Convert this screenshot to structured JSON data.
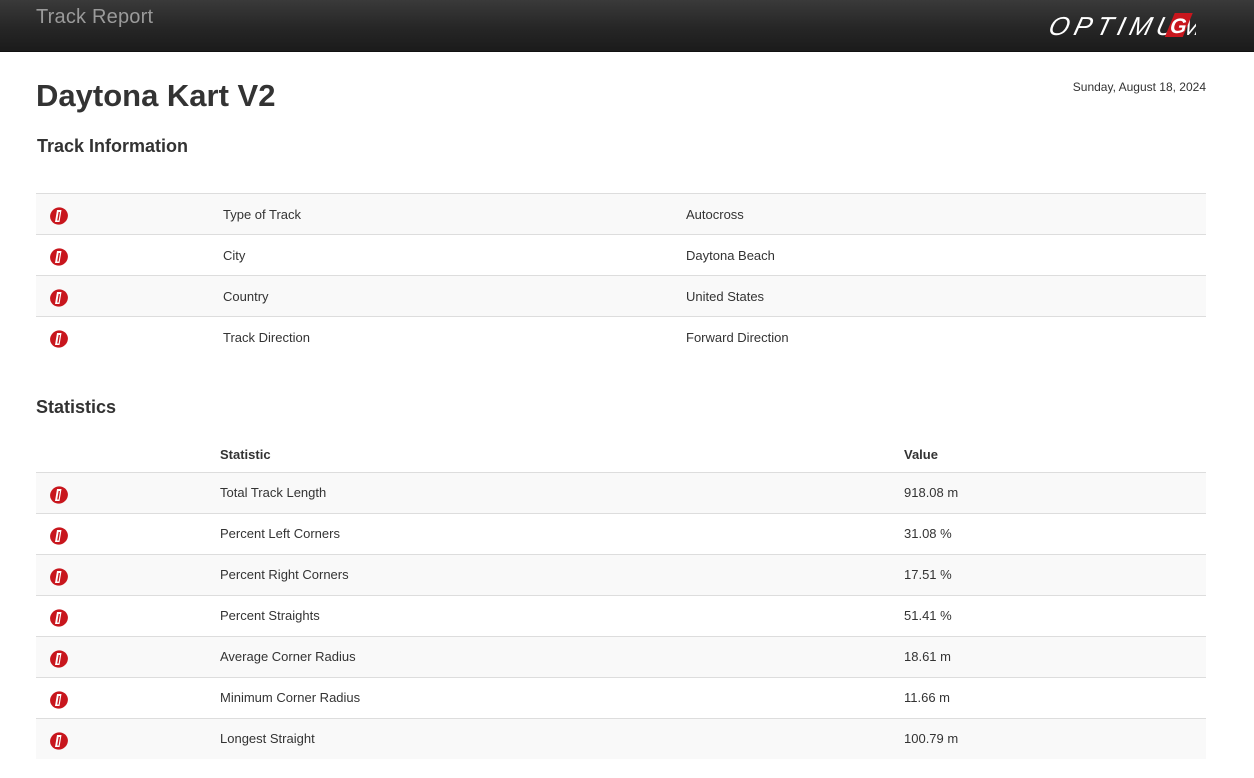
{
  "header": {
    "app_title": "Track Report",
    "brand_name": "OPTIMUMG"
  },
  "report": {
    "title": "Daytona Kart V2",
    "date": "Sunday, August 18, 2024"
  },
  "track_information": {
    "heading": "Track Information",
    "rows": [
      {
        "icon": "optimumg-logo-icon",
        "label": "Type of Track",
        "value": "Autocross"
      },
      {
        "icon": "optimumg-logo-icon",
        "label": "City",
        "value": "Daytona Beach"
      },
      {
        "icon": "optimumg-logo-icon",
        "label": "Country",
        "value": "United States"
      },
      {
        "icon": "optimumg-logo-icon",
        "label": "Track Direction",
        "value": "Forward Direction"
      }
    ]
  },
  "statistics": {
    "heading": "Statistics",
    "columns": [
      "Statistic",
      "Value"
    ],
    "rows": [
      {
        "icon": "optimumg-logo-icon",
        "label": "Total Track Length",
        "value": "918.08 m"
      },
      {
        "icon": "optimumg-logo-icon",
        "label": "Percent Left Corners",
        "value": "31.08 %"
      },
      {
        "icon": "optimumg-logo-icon",
        "label": "Percent Right Corners",
        "value": "17.51 %"
      },
      {
        "icon": "optimumg-logo-icon",
        "label": "Percent Straights",
        "value": "51.41 %"
      },
      {
        "icon": "optimumg-logo-icon",
        "label": "Average Corner Radius",
        "value": "18.61 m"
      },
      {
        "icon": "optimumg-logo-icon",
        "label": "Minimum Corner Radius",
        "value": "11.66 m"
      },
      {
        "icon": "optimumg-logo-icon",
        "label": "Longest Straight",
        "value": "100.79 m"
      }
    ]
  },
  "colors": {
    "header_bg": "#262626",
    "header_text": "#9a9a9a",
    "brand_red": "#c8161d",
    "row_stripe": "#f9f9f9",
    "row_border": "#dddddd",
    "text": "#333333"
  }
}
